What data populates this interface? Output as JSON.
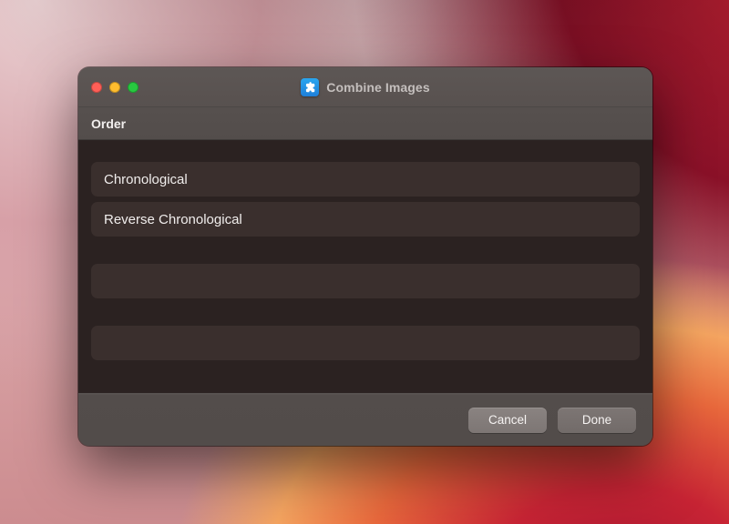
{
  "titlebar": {
    "app_name": "Combine Images"
  },
  "header": {
    "label": "Order"
  },
  "options": [
    {
      "label": "Chronological"
    },
    {
      "label": "Reverse Chronological"
    },
    {
      "label": ""
    },
    {
      "label": ""
    }
  ],
  "footer": {
    "cancel_label": "Cancel",
    "done_label": "Done"
  },
  "colors": {
    "icon_bg": "#23a2ee"
  }
}
